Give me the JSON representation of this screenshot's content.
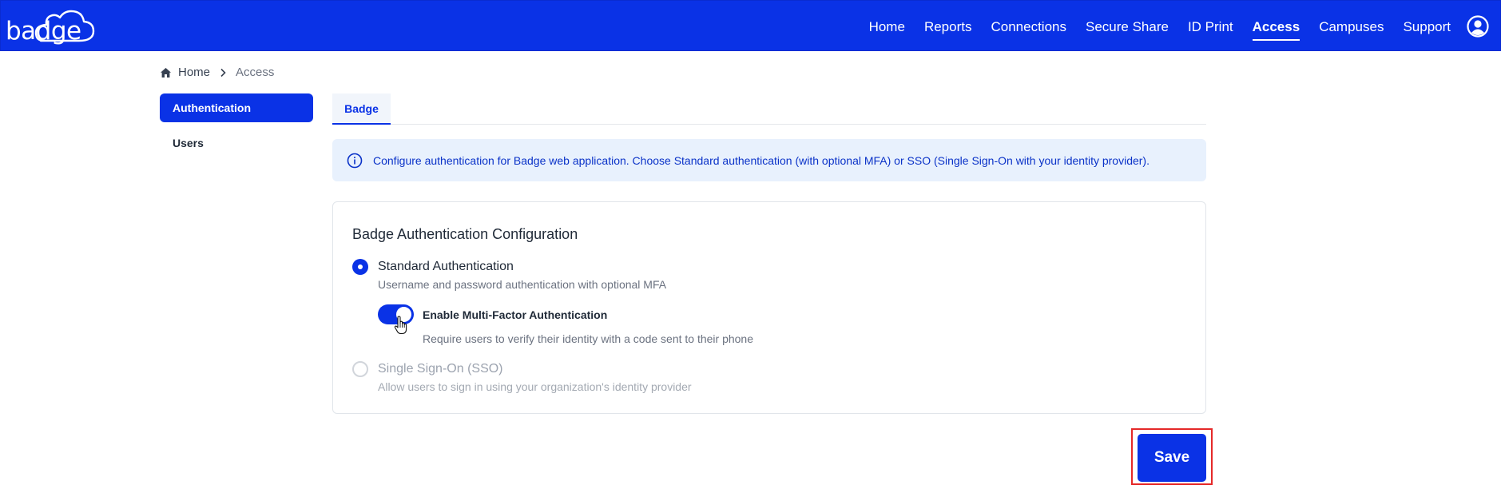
{
  "app": {
    "logo_text": "badge"
  },
  "nav": {
    "items": [
      "Home",
      "Reports",
      "Connections",
      "Secure Share",
      "ID Print",
      "Access",
      "Campuses",
      "Support"
    ],
    "active": "Access"
  },
  "breadcrumb": {
    "home": "Home",
    "current": "Access"
  },
  "sidebar": {
    "items": [
      {
        "label": "Authentication",
        "active": true
      },
      {
        "label": "Users",
        "active": false
      }
    ]
  },
  "tabs": [
    {
      "label": "Badge",
      "active": true
    }
  ],
  "info": {
    "text": "Configure authentication for Badge web application. Choose Standard authentication (with optional MFA) or SSO (Single Sign-On with your identity provider)."
  },
  "card": {
    "title": "Badge Authentication Configuration",
    "standard": {
      "title": "Standard Authentication",
      "description": "Username and password authentication with optional MFA",
      "selected": true
    },
    "mfa": {
      "title": "Enable Multi-Factor Authentication",
      "description": "Require users to verify their identity with a code sent to their phone",
      "enabled": true
    },
    "sso": {
      "title": "Single Sign-On (SSO)",
      "description": "Allow users to sign in using your organization's identity provider",
      "selected": false
    }
  },
  "save_label": "Save",
  "colors": {
    "primary": "#0a32e6",
    "info_bg": "#e8f1fd",
    "highlight": "#e52929",
    "muted": "#6b7280",
    "disabled": "#9ca3af"
  }
}
